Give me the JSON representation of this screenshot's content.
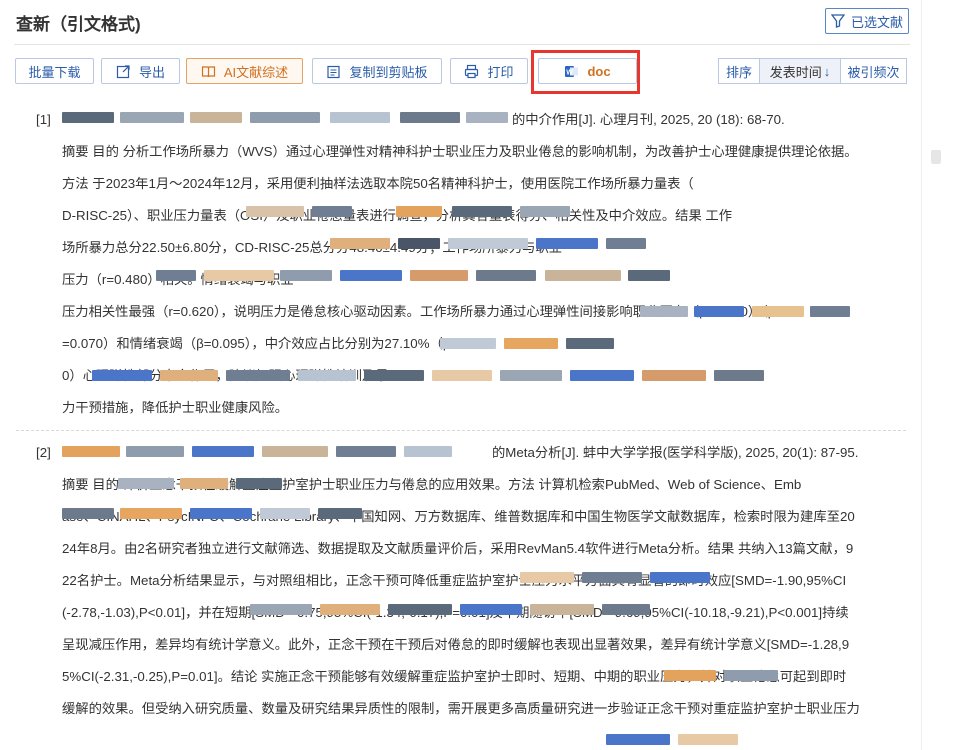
{
  "header": {
    "title": "查新（引文格式)",
    "selected_button": "已选文献"
  },
  "toolbar": {
    "batch_download": "批量下载",
    "export": "导出",
    "ai_review": "AI文献综述",
    "copy_clipboard": "复制到剪贴板",
    "print": "打印",
    "doc": "doc"
  },
  "sort": {
    "label": "排序",
    "publish_time": "发表时间",
    "cited_count": "被引频次",
    "active_arrow": "↓"
  },
  "references": [
    {
      "number": "[1]",
      "citation_visible": "的中介作用[J]. 心理月刊, 2025, 20 (18): 68-70.",
      "abstract_lines": [
        "摘要 目的 分析工作场所暴力（WVS）通过心理弹性对精神科护士职业压力及职业倦怠的影响机制，为改善护士心理健康提供理论依据。",
        "方法 于2023年1月～2024年12月，采用便利抽样法选取本院50名精神科护士，使用医院工作场所暴力量表（",
        "D-RISC-25）、职业压力量表（OSI）及职业倦怠量表进行调查，分析其各量表得分、相关性及中介效应。结果 工作",
        "场所暴力总分22.50±6.80分，CD-RISC-25总分分48.40±4.49分；工作场所暴力与职业",
        "压力（r=0.480）相关。情绪衰竭与职业",
        "压力相关性最强（r=0.620），说明压力是倦怠核心驱动因素。工作场所暴力通过心理弹性间接影响职业压力（β=0.130）（β",
        "=0.070）和情绪衰竭（β=0.095），中介效应占比分别为27.10%（β=0.15",
        "0）心理弹性部分中介作用，建议加强心理弹性培训及暴",
        "力干预措施，降低护士职业健康风险。"
      ]
    },
    {
      "number": "[2]",
      "citation_visible": "的Meta分析[J]. 蚌中大学学报(医学科学版), 2025, 20(1): 87-95.",
      "abstract_lines": [
        "摘要 目的 评价正念干预在缓解重症监护室护士职业压力与倦怠的应用效果。方法 计算机检索PubMed、Web of Science、Emb",
        "ase、CINAHL、PsycINFO、Cochrane Library、中国知网、万方数据库、维普数据库和中国生物医学文献数据库，检索时限为建库至20",
        "24年8月。由2名研究者独立进行文献筛选、数据提取及文献质量评价后，采用RevMan5.4软件进行Meta分析。结果 共纳入13篇文献，9",
        "22名护士。Meta分析结果显示，与对照组相比，正念干预可降低重症监护室护士压力水平方面具有显著的即时效应[SMD=-1.90,95%CI",
        "(-2.78,-1.03),P<0.01]，并在短期[SMD=-0.75,95%CI(-1.34,-0.17),P=0.01]及中期随访中[SMD=-9.69,95%CI(-10.18,-9.21),P<0.001]持续",
        "呈现减压作用，差异均有统计学意义。此外，正念干预在干预后对倦怠的即时缓解也表现出显著效果，差异有统计学意义[SMD=-1.28,9",
        "5%CI(-2.31,-0.25),P=0.01]。结论 实施正念干预能够有效缓解重症监护室护士即时、短期、中期的职业压力，并对职业倦怠可起到即时",
        "缓解的效果。但受纳入研究质量、数量及研究结果异质性的限制，需开展更多高质量研究进一步验证正念干预对重症监护室护士职业压力"
      ]
    }
  ],
  "colors": {
    "accent": "#2a5caa",
    "ai_orange": "#d07020",
    "highlight_red": "#e6362d"
  }
}
